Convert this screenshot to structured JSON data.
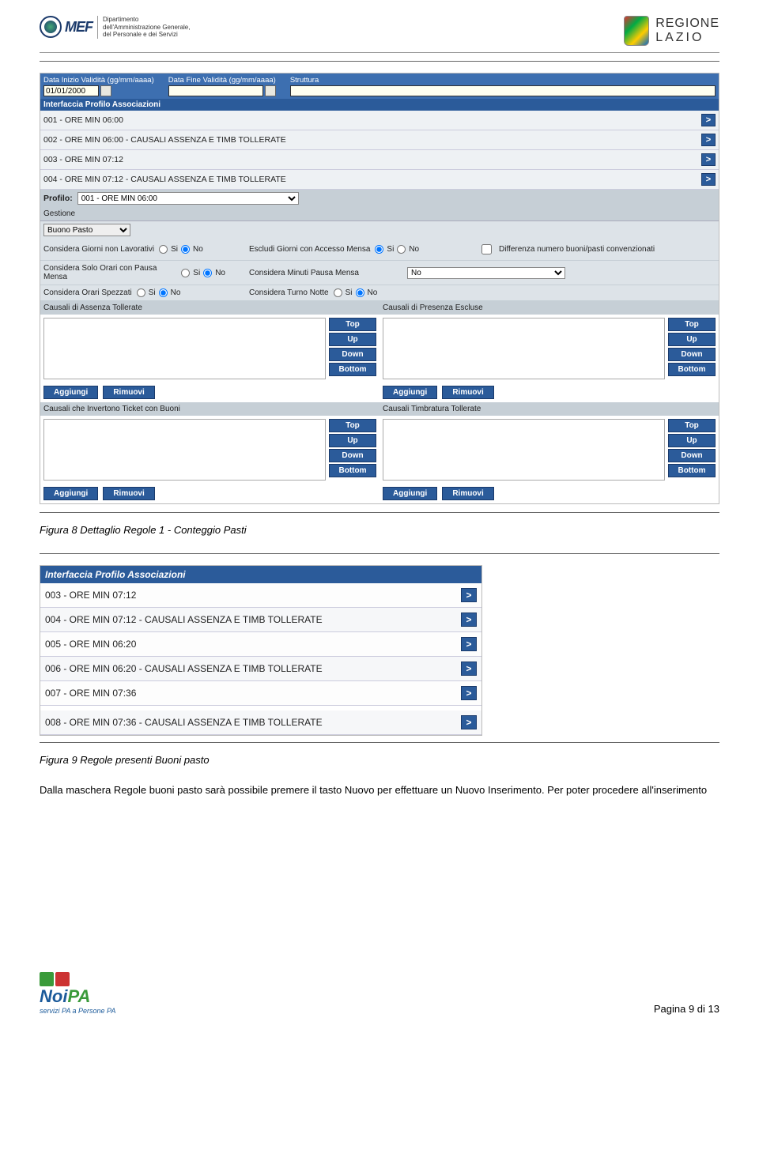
{
  "header": {
    "dept_line1": "Dipartimento",
    "dept_line2": "dell'Amministrazione Generale,",
    "dept_line3": "del Personale e dei Servizi",
    "region_line1": "REGIONE",
    "region_line2": "LAZIO"
  },
  "shot1": {
    "fields": {
      "data_inizio_label": "Data Inizio Validità (gg/mm/aaaa)",
      "data_inizio_value": "01/01/2000",
      "data_fine_label": "Data Fine Validità (gg/mm/aaaa)",
      "struttura_label": "Struttura"
    },
    "assoc_header": "Interfaccia Profilo Associazioni",
    "assoc_rows": [
      "001 - ORE MIN 06:00",
      "002 - ORE MIN 06:00 - CAUSALI ASSENZA E TIMB TOLLERATE",
      "003 - ORE MIN 07:12",
      "004 - ORE MIN 07:12 - CAUSALI ASSENZA E TIMB TOLLERATE"
    ],
    "profilo_label": "Profilo:",
    "profilo_value": "001 - ORE MIN 06:00",
    "gestione_label": "Gestione",
    "gestione_value": "Buono Pasto",
    "radio_rows": [
      {
        "l1": "Considera Giorni non Lavorativi",
        "l2": "Escludi Giorni con Accesso Mensa",
        "l3": "Differenza numero buoni/pasti convenzionati"
      },
      {
        "l1": "Considera Solo Orari con Pausa Mensa",
        "l2": "Considera Minuti Pausa Mensa",
        "sel": "No"
      },
      {
        "l1": "Considera Orari Spezzati",
        "l2": "Considera Turno Notte"
      }
    ],
    "si": "Si",
    "no": "No",
    "dual1": {
      "left": "Causali di Assenza Tollerate",
      "right": "Causali di Presenza Escluse"
    },
    "dual2": {
      "left": "Causali che Invertono Ticket con Buoni",
      "right": "Causali Timbratura Tollerate"
    },
    "btns": {
      "top": "Top",
      "up": "Up",
      "down": "Down",
      "bottom": "Bottom",
      "aggiungi": "Aggiungi",
      "rimuovi": "Rimuovi"
    }
  },
  "caption1": "Figura 8 Dettaglio Regole 1 - Conteggio Pasti",
  "shot2": {
    "header": "Interfaccia Profilo Associazioni",
    "rows": [
      "003 - ORE MIN 07:12",
      "004 - ORE MIN 07:12 - CAUSALI ASSENZA E TIMB TOLLERATE",
      "005 - ORE MIN 06:20",
      "006 - ORE MIN 06:20 - CAUSALI ASSENZA E TIMB TOLLERATE",
      "007 - ORE MIN 07:36",
      "008 - ORE MIN 07:36 - CAUSALI ASSENZA E TIMB TOLLERATE"
    ]
  },
  "caption2": "Figura 9 Regole presenti Buoni pasto",
  "body": "Dalla maschera Regole buoni pasto sarà possibile premere il tasto Nuovo per effettuare un Nuovo Inserimento. Per poter procedere all'inserimento",
  "footer": {
    "noipa_sub": "servizi PA a Persone PA",
    "page": "Pagina 9 di 13"
  }
}
